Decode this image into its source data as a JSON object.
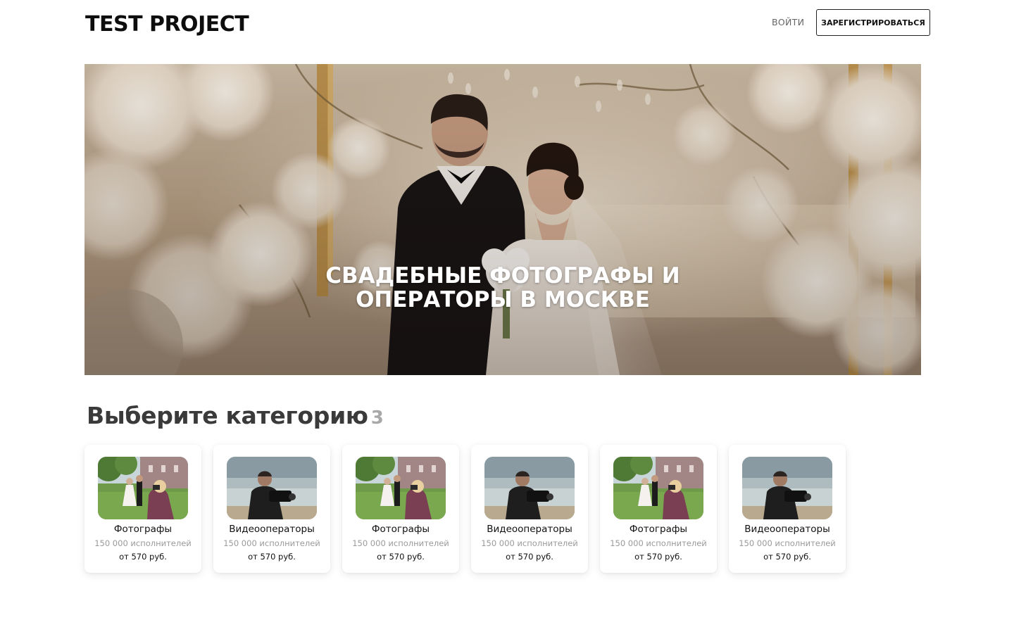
{
  "header": {
    "logo": "TEST PROJECT",
    "login_label": "ВОЙТИ",
    "register_label": "ЗАРЕГИСТРИРОВАТЬСЯ"
  },
  "hero": {
    "title": "СВАДЕБНЫЕ ФОТОГРАФЫ И ОПЕРАТОРЫ В МОСКВЕ"
  },
  "categories": {
    "title": "Выберите категорию",
    "count": "3",
    "items": [
      {
        "name": "Фотографы",
        "count": "150 000  исполнителей",
        "price": "от 570 руб.",
        "image": "photographer-photo"
      },
      {
        "name": "Видеооператоры",
        "count": "150 000  исполнителей",
        "price": "от 570 руб.",
        "image": "videographer-photo"
      },
      {
        "name": "Фотографы",
        "count": "150 000  исполнителей",
        "price": "от 570 руб.",
        "image": "photographer-photo"
      },
      {
        "name": "Видеооператоры",
        "count": "150 000  исполнителей",
        "price": "от 570 руб.",
        "image": "videographer-photo"
      },
      {
        "name": "Фотографы",
        "count": "150 000  исполнителей",
        "price": "от 570 руб.",
        "image": "photographer-photo"
      },
      {
        "name": "Видеооператоры",
        "count": "150 000  исполнителей",
        "price": "от 570 руб.",
        "image": "videographer-photo"
      }
    ]
  }
}
